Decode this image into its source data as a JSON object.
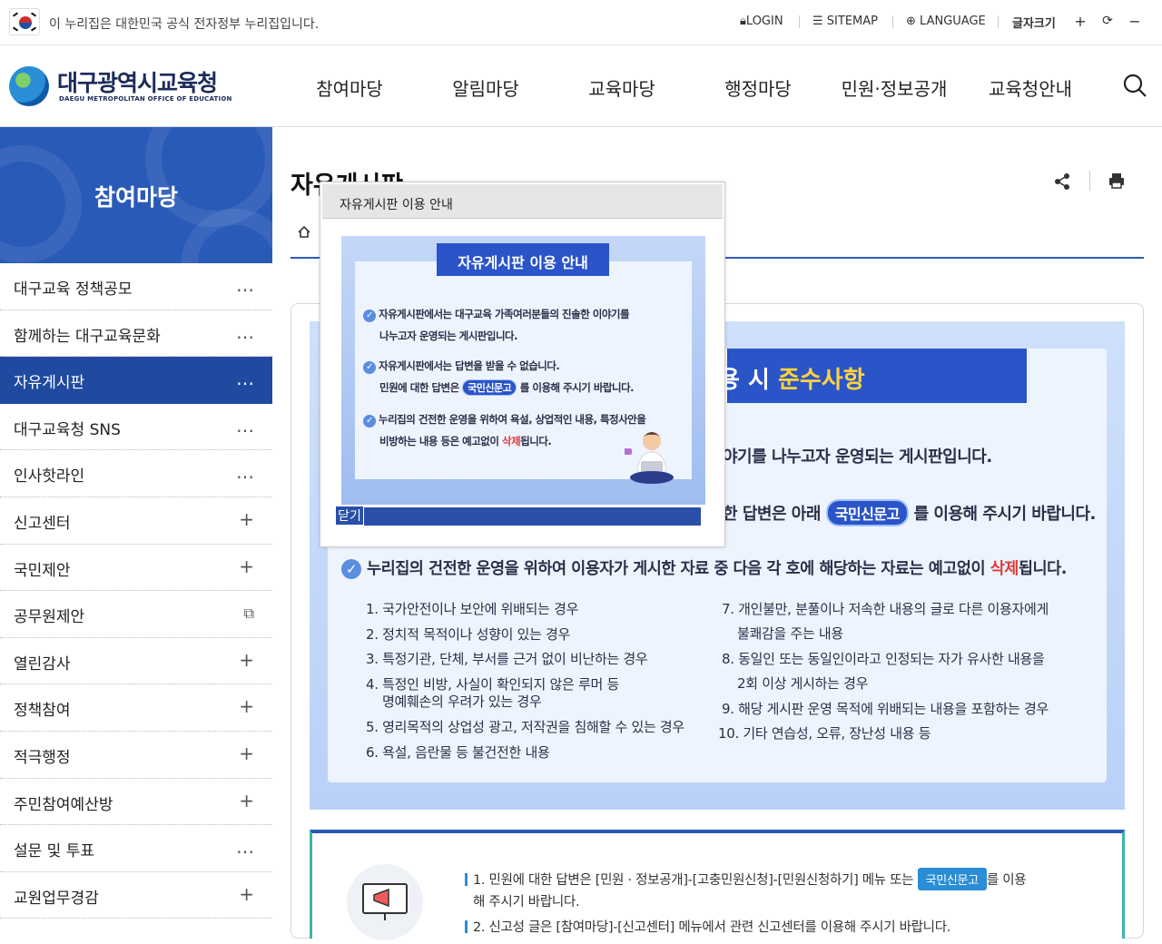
{
  "topbar": {
    "gov_notice": "이 누리집은 대한민국 공식 전자정부 누리집입니다.",
    "login": "LOGIN",
    "sitemap": "SITEMAP",
    "language": "LANGUAGE",
    "font_size_label": "글자크기",
    "font_plus": "+",
    "font_reset": "⟳",
    "font_minus": "−"
  },
  "header": {
    "logo_title": "대구광역시교육청",
    "logo_subtitle": "DAEGU METROPOLITAN OFFICE OF EDUCATION",
    "nav": [
      "참여마당",
      "알림마당",
      "교육마당",
      "행정마당",
      "민원·정보공개",
      "교육청안내"
    ]
  },
  "sidebar": {
    "title": "참여마당",
    "items": [
      {
        "label": "대구교육 정책공모",
        "icon": "…"
      },
      {
        "label": "함께하는 대구교육문화",
        "icon": "…"
      },
      {
        "label": "자유게시판",
        "icon": "…"
      },
      {
        "label": "대구교육청 SNS",
        "icon": "…"
      },
      {
        "label": "인사핫라인",
        "icon": "…"
      },
      {
        "label": "신고센터",
        "icon": "+"
      },
      {
        "label": "국민제안",
        "icon": "+"
      },
      {
        "label": "공무원제안",
        "icon": "⧉"
      },
      {
        "label": "열린감사",
        "icon": "+"
      },
      {
        "label": "정책참여",
        "icon": "+"
      },
      {
        "label": "적극행정",
        "icon": "+"
      },
      {
        "label": "주민참여예산방",
        "icon": "+"
      },
      {
        "label": "설문 및 투표",
        "icon": "…"
      },
      {
        "label": "교원업무경감",
        "icon": "+"
      }
    ]
  },
  "content": {
    "page_title": "자유게시판",
    "banner": {
      "ribbon_partial": "용 시 ",
      "ribbon_highlight": "준수사항",
      "line1": "야기를 나누고자 운영되는 게시판입니다.",
      "line2_pre": "한 답변은 아래",
      "line2_pill": "국민신문고",
      "line2_post": "를 이용해 주시기 바랍니다.",
      "line3_pre": "누리집의 건전한 운영을 위하여 이용자가 게시한 자료 중 다음 각 호에 해당하는 자료는 예고없이",
      "line3_red": "삭제",
      "line3_post": "됩니다.",
      "rules_left": [
        "1. 국가안전이나 보안에 위배되는 경우",
        "2. 정치적 목적이나 성향이 있는 경우",
        "3. 특정기관, 단체, 부서를 근거 없이 비난하는 경우",
        "4. 특정인 비방, 사실이 확인되지 않은 루머 등",
        "명예훼손의 우려가 있는 경우",
        "5. 영리목적의 상업성 광고, 저작권을 침해할 수 있는 경우",
        "6. 욕설, 음란물 등 불건전한 내용"
      ],
      "rules_right": [
        "7. 개인불만, 분풀이나 저속한 내용의 글로 다른 이용자에게",
        "불쾌감을 주는 내용",
        "8. 동일인 또는 동일인이라고 인정되는 자가 유사한 내용을",
        "2회 이상 게시하는 경우",
        "9. 해당 게시판 운영 목적에 위배되는 내용을 포함하는 경우",
        "10. 기타 연습성, 오류, 장난성 내용 등"
      ]
    },
    "info": {
      "line1_pre": "1. 민원에 대한 답변은 [민원 · 정보공개]-[고충민원신청]-[민원신청하기] 메뉴 또는",
      "line1_pill": "국민신문고",
      "line1_post": "를 이용",
      "line1b": "해 주시기 바랍니다.",
      "line2": "2. 신고성 글은 [참여마당]-[신고센터] 메뉴에서 관련 신고센터를 이용해 주시기 바랍니다."
    }
  },
  "modal": {
    "title": "자유게시판 이용 안내",
    "ribbon": "자유게시판 이용 안내",
    "l1a": "자유게시판에서는 대구교육 가족여러분들의 진솔한 이야기를",
    "l1b": "나누고자 운영되는 게시판입니다.",
    "l2a": "자유게시판에서는 답변을 받을 수 없습니다.",
    "l2b_pre": "민원에 대한 답변은",
    "l2b_pill": "국민신문고",
    "l2b_post": "를 이용해 주시기 바랍니다.",
    "l3a": "누리집의 건전한 운영을 위하여 욕설, 상업적인 내용, 특정사안을",
    "l3b_pre": "비방하는 내용 등은 예고없이",
    "l3b_red": "삭제",
    "l3b_post": "됩니다.",
    "close": "닫기"
  }
}
